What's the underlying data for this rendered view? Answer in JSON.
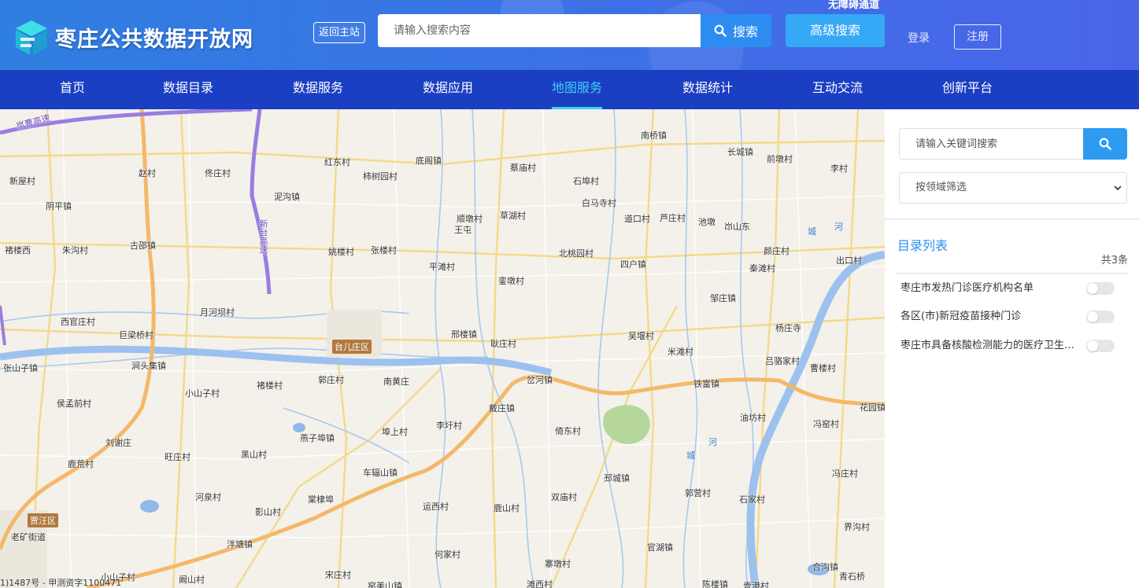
{
  "header": {
    "site_title": "枣庄公共数据开放网",
    "back_home": "返回主站",
    "search_placeholder": "请输入搜索内容",
    "search_label": "搜索",
    "advanced_search": "高级搜索",
    "barrier_free": "无障碍通道",
    "login": "登录",
    "register": "注册",
    "logo_icon": "cube-logo-icon"
  },
  "nav": {
    "items": [
      {
        "label": "首页"
      },
      {
        "label": "数据目录"
      },
      {
        "label": "数据服务"
      },
      {
        "label": "数据应用"
      },
      {
        "label": "地图服务",
        "active": true
      },
      {
        "label": "数据统计"
      },
      {
        "label": "互动交流"
      },
      {
        "label": "创新平台"
      }
    ]
  },
  "map": {
    "districts": [
      "台儿庄区",
      "贾汪区"
    ],
    "road_labels": [
      "岚曹高速",
      "新台高速"
    ],
    "places": [
      "南桥镇",
      "长城镇",
      "前墩村",
      "李村",
      "红东村",
      "底阁镇",
      "蔡庙村",
      "赵村",
      "佟庄村",
      "柿树园村",
      "石埠村",
      "新屋村",
      "泥沟镇",
      "白马寺村",
      "阴平镇",
      "顺墩村",
      "王屯",
      "草湖村",
      "道口村",
      "芦庄村",
      "池墩",
      "岇山东",
      "褚楼西",
      "朱沟村",
      "古邵镇",
      "姚楼村",
      "张楼村",
      "北桃园村",
      "颜庄村",
      "平滩村",
      "四户镇",
      "出口村",
      "秦滩村",
      "銮墩村",
      "邹庄镇",
      "月河坝村",
      "西官庄村",
      "杨庄寺",
      "巨梁桥村",
      "邢楼镇",
      "吴堰村",
      "耿庄村",
      "张山子镇",
      "米滩村",
      "吕骆家村",
      "涧头集镇",
      "曹楼村",
      "郭庄村",
      "南黄庄",
      "褚楼村",
      "岔河镇",
      "铁富镇",
      "小山子村",
      "花园镇",
      "侯孟前村",
      "油坊村",
      "戴庄镇",
      "冯窑村",
      "埠上村",
      "李圩村",
      "倚东村",
      "燕子埠镇",
      "刘谢庄",
      "旺庄村",
      "黑山村",
      "鹿荒村",
      "冯庄村",
      "车辐山镇",
      "邳城镇",
      "棠棣埠",
      "河泉村",
      "运西村",
      "鹿山村",
      "双庙村",
      "郭营村",
      "石家村",
      "影山村",
      "界沟村",
      "老矿街道",
      "泮塘镇",
      "官湖镇",
      "何家村",
      "合沟镇",
      "小山子村",
      "宋庄村",
      "寨墩村",
      "青石桥",
      "阚山村",
      "窑美山镇",
      "滩西村",
      "陈楼镇",
      "壹港村"
    ],
    "rivers": [
      "城",
      "河",
      "河",
      "城"
    ],
    "copyright": "1)1487号 - 甲测资字1100471"
  },
  "sidebar": {
    "keyword_placeholder": "请输入关键词搜索",
    "domain_filter": "按领域筛选",
    "catalog_title": "目录列表",
    "catalog_count": "共3条",
    "items": [
      {
        "label": "枣庄市发热门诊医疗机构名单",
        "enabled": false
      },
      {
        "label": "各区(市)新冠疫苗接种门诊",
        "enabled": false
      },
      {
        "label": "枣庄市具备核酸检测能力的医疗卫生机构",
        "enabled": false
      }
    ]
  },
  "colors": {
    "header_bg": "#3a73e6",
    "nav_bg": "#1b3fc2",
    "nav_active": "#3ad0f5",
    "search_btn": "#2d8cf0",
    "advanced_btn": "#35a9f5",
    "catalog_title": "#2d8cf0"
  }
}
